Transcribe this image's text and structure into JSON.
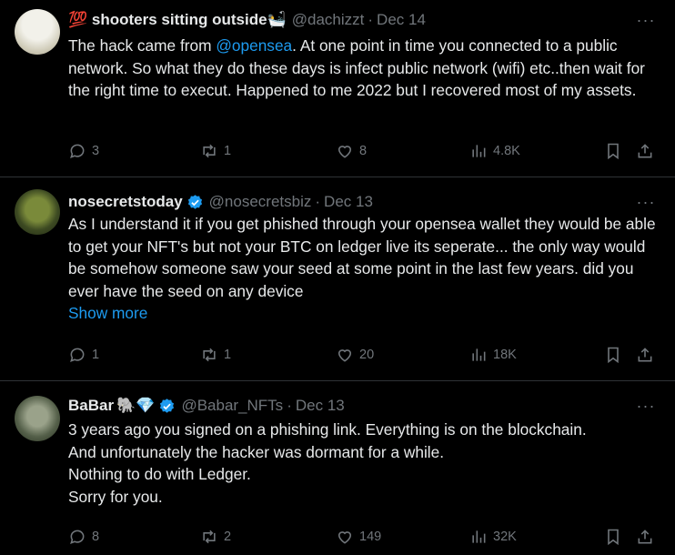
{
  "posts": [
    {
      "name": "💯 shooters sitting outside🛀",
      "handle": "@dachizzt",
      "date": "Dec 14",
      "text_before": "The hack came from ",
      "mention": "@opensea",
      "text_after": ". At one point in time you connected to a public network. So what they do these days is infect public network (wifi) etc..then wait for the right time to execut. Happened to me 2022 but I recovered most of my assets.",
      "replies": "3",
      "reposts": "1",
      "likes": "8",
      "views": "4.8K"
    },
    {
      "name": "nosecretstoday",
      "handle": "@nosecretsbiz",
      "date": "Dec 13",
      "text": "As I understand it if you get phished through your opensea wallet they would be able to get your NFT's but not your BTC on ledger live its seperate... the only way would be somehow someone saw your seed at some point in the last few years. did you ever have the seed on any device",
      "show_more": "Show more",
      "replies": "1",
      "reposts": "1",
      "likes": "20",
      "views": "18K"
    },
    {
      "name": "BaBar",
      "name_emoji": "🐘💎",
      "handle": "@Babar_NFTs",
      "date": "Dec 13",
      "lines": [
        "3 years ago you signed on a phishing link. Everything is on the blockchain.",
        "And unfortunately the hacker was dormant for a while.",
        "Nothing to do with Ledger.",
        "Sorry for you."
      ],
      "replies": "8",
      "reposts": "2",
      "likes": "149",
      "views": "32K"
    }
  ],
  "ui": {
    "dot": "·",
    "more": "···"
  },
  "colors": {
    "accent": "#1d9bf0",
    "muted": "#71767b",
    "text": "#e7e9ea",
    "background": "#000000"
  }
}
